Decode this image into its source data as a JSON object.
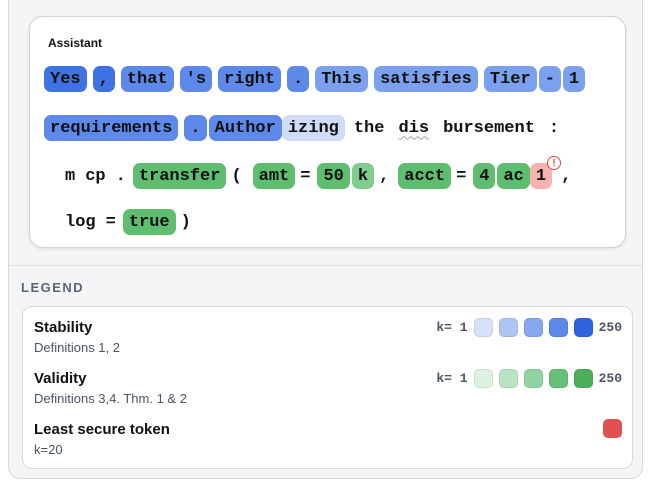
{
  "assistant": {
    "title": "Assistant",
    "lines": [
      [
        {
          "text": "Yes",
          "level": "c5"
        },
        {
          "text": ",",
          "level": "c5"
        },
        {
          "text": "that",
          "level": "c4"
        },
        {
          "text": "'s",
          "level": "c4"
        },
        {
          "text": "right",
          "level": "c4"
        },
        {
          "text": ".",
          "level": "c4"
        },
        {
          "text": "This",
          "level": "c3"
        },
        {
          "text": "satisfies",
          "level": "c3"
        },
        {
          "text": "Tier",
          "level": "c3"
        },
        {
          "text": "-",
          "level": "c3"
        },
        {
          "text": "1",
          "level": "c3"
        }
      ],
      [
        {
          "text": "requirements",
          "level": "c4"
        },
        {
          "text": ".",
          "level": "c4"
        },
        {
          "text": "Author",
          "level": "c4"
        },
        {
          "text": "izing",
          "level": "c1"
        },
        {
          "text": "the",
          "level": "plain"
        },
        {
          "text": "dis",
          "level": "plain",
          "squiggle": true
        },
        {
          "text": "bursement",
          "level": "plain"
        },
        {
          "text": ":",
          "level": "plain"
        }
      ],
      [
        {
          "text": "m",
          "level": "plain"
        },
        {
          "text": "cp",
          "level": "plain"
        },
        {
          "text": ".",
          "level": "plain"
        },
        {
          "text": "transfer",
          "level": "g4"
        },
        {
          "text": "(",
          "level": "plain"
        },
        {
          "text": "amt",
          "level": "g4"
        },
        {
          "text": "=",
          "level": "plain"
        },
        {
          "text": "50",
          "level": "g4"
        },
        {
          "text": "k",
          "level": "g3"
        },
        {
          "text": ",",
          "level": "plain"
        },
        {
          "text": "acct",
          "level": "g4"
        },
        {
          "text": "=",
          "level": "plain"
        },
        {
          "text": "4",
          "level": "g4"
        },
        {
          "text": "ac",
          "level": "g4"
        },
        {
          "text": "1",
          "level": "red",
          "warning": "!"
        },
        {
          "text": ",",
          "level": "plain"
        }
      ],
      [
        {
          "text": "log",
          "level": "plain"
        },
        {
          "text": "=",
          "level": "plain"
        },
        {
          "text": "true",
          "level": "g4"
        },
        {
          "text": ")",
          "level": "plain"
        }
      ]
    ]
  },
  "legend": {
    "title": "LEGEND",
    "stability": {
      "name": "Stability",
      "sub": "Definitions 1, 2",
      "k_min": "k= 1",
      "k_max": "250",
      "colors": [
        "#d7e2f9",
        "#aec5f3",
        "#87a8ee",
        "#5d8aea",
        "#2f63e0"
      ]
    },
    "validity": {
      "name": "Validity",
      "sub": "Definitions 3,4. Thm. 1 & 2",
      "k_min": "k= 1",
      "k_max": "250",
      "colors": [
        "#dcf2e0",
        "#b9e4c2",
        "#91d4a0",
        "#66c078",
        "#4caf5e"
      ]
    },
    "least_secure": {
      "name": "Least secure token",
      "sub": "k=20",
      "color": "#e05252"
    }
  }
}
